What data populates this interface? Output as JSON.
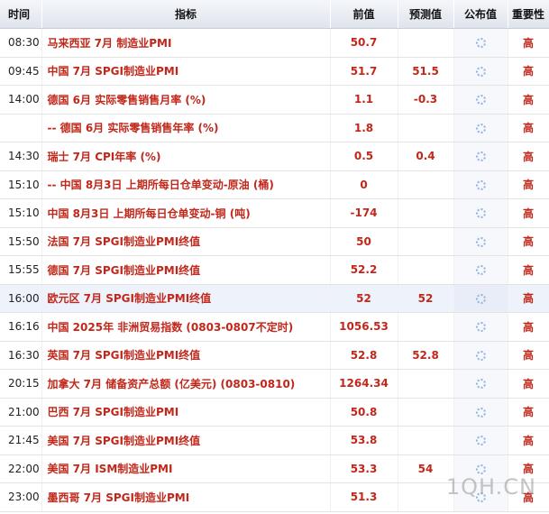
{
  "header": {
    "time": "时间",
    "indicator": "指标",
    "previous": "前值",
    "forecast": "预测值",
    "actual": "公布值",
    "importance": "重要性"
  },
  "rows": [
    {
      "time": "08:30",
      "indicator": "马来西亚 7月 制造业PMI",
      "previous": "50.7",
      "forecast": "",
      "importance": "高"
    },
    {
      "time": "09:45",
      "indicator": "中国 7月 SPGI制造业PMI",
      "previous": "51.7",
      "forecast": "51.5",
      "importance": "高"
    },
    {
      "time": "14:00",
      "indicator": "德国 6月 实际零售销售月率 (%)",
      "previous": "1.1",
      "forecast": "-0.3",
      "importance": "高"
    },
    {
      "time": "",
      "indicator": "-- 德国 6月 实际零售销售年率 (%)",
      "previous": "1.8",
      "forecast": "",
      "importance": "高"
    },
    {
      "time": "14:30",
      "indicator": "瑞士 7月 CPI年率 (%)",
      "previous": "0.5",
      "forecast": "0.4",
      "importance": "高"
    },
    {
      "time": "15:10",
      "indicator": "-- 中国 8月3日 上期所每日仓单变动-原油 (桶)",
      "previous": "0",
      "forecast": "",
      "importance": "高"
    },
    {
      "time": "15:10",
      "indicator": "中国 8月3日 上期所每日仓单变动-铜 (吨)",
      "previous": "-174",
      "forecast": "",
      "importance": "高"
    },
    {
      "time": "15:50",
      "indicator": "法国 7月 SPGI制造业PMI终值",
      "previous": "50",
      "forecast": "",
      "importance": "高"
    },
    {
      "time": "15:55",
      "indicator": "德国 7月 SPGI制造业PMI终值",
      "previous": "52.2",
      "forecast": "",
      "importance": "高"
    },
    {
      "time": "16:00",
      "indicator": "欧元区 7月 SPGI制造业PMI终值",
      "previous": "52",
      "forecast": "52",
      "importance": "高",
      "highlight": true
    },
    {
      "time": "16:16",
      "indicator": "中国 2025年 非洲贸易指数 (0803-0807不定时)",
      "previous": "1056.53",
      "forecast": "",
      "importance": "高"
    },
    {
      "time": "16:30",
      "indicator": "英国 7月 SPGI制造业PMI终值",
      "previous": "52.8",
      "forecast": "52.8",
      "importance": "高"
    },
    {
      "time": "20:15",
      "indicator": "加拿大 7月 储备资产总额 (亿美元) (0803-0810)",
      "previous": "1264.34",
      "forecast": "",
      "importance": "高"
    },
    {
      "time": "21:00",
      "indicator": "巴西 7月 SPGI制造业PMI",
      "previous": "50.8",
      "forecast": "",
      "importance": "高"
    },
    {
      "time": "21:45",
      "indicator": "美国 7月 SPGI制造业PMI终值",
      "previous": "53.8",
      "forecast": "",
      "importance": "高"
    },
    {
      "time": "22:00",
      "indicator": "美国 7月 ISM制造业PMI",
      "previous": "53.3",
      "forecast": "54",
      "importance": "高"
    },
    {
      "time": "23:00",
      "indicator": "墨西哥 7月 SPGI制造业PMI",
      "previous": "51.3",
      "forecast": "",
      "importance": "高"
    }
  ],
  "watermark": "1QH.CN",
  "icons": {
    "actual_pending": "loading-spinner-icon"
  },
  "colors": {
    "value_red": "#c1271a",
    "header_bg": "#dfe4ec",
    "highlight_row": "#eef2fb"
  }
}
